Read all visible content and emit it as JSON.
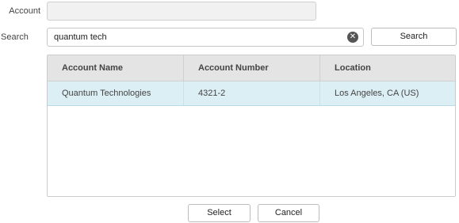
{
  "form": {
    "account_label": "Account",
    "account_value": "",
    "search_label": "Search",
    "search_value": "quantum tech",
    "search_button": "Search"
  },
  "results": {
    "columns": [
      "Account Name",
      "Account Number",
      "Location"
    ],
    "rows": [
      {
        "account_name": "Quantum Technologies",
        "account_number": "4321-2",
        "location": "Los Angeles, CA (US)"
      }
    ]
  },
  "actions": {
    "select_label": "Select",
    "cancel_label": "Cancel"
  },
  "icons": {
    "clear": "clear-search-icon"
  },
  "colors": {
    "header_bg": "#e4e4e4",
    "selected_row_bg": "#dceff5"
  }
}
